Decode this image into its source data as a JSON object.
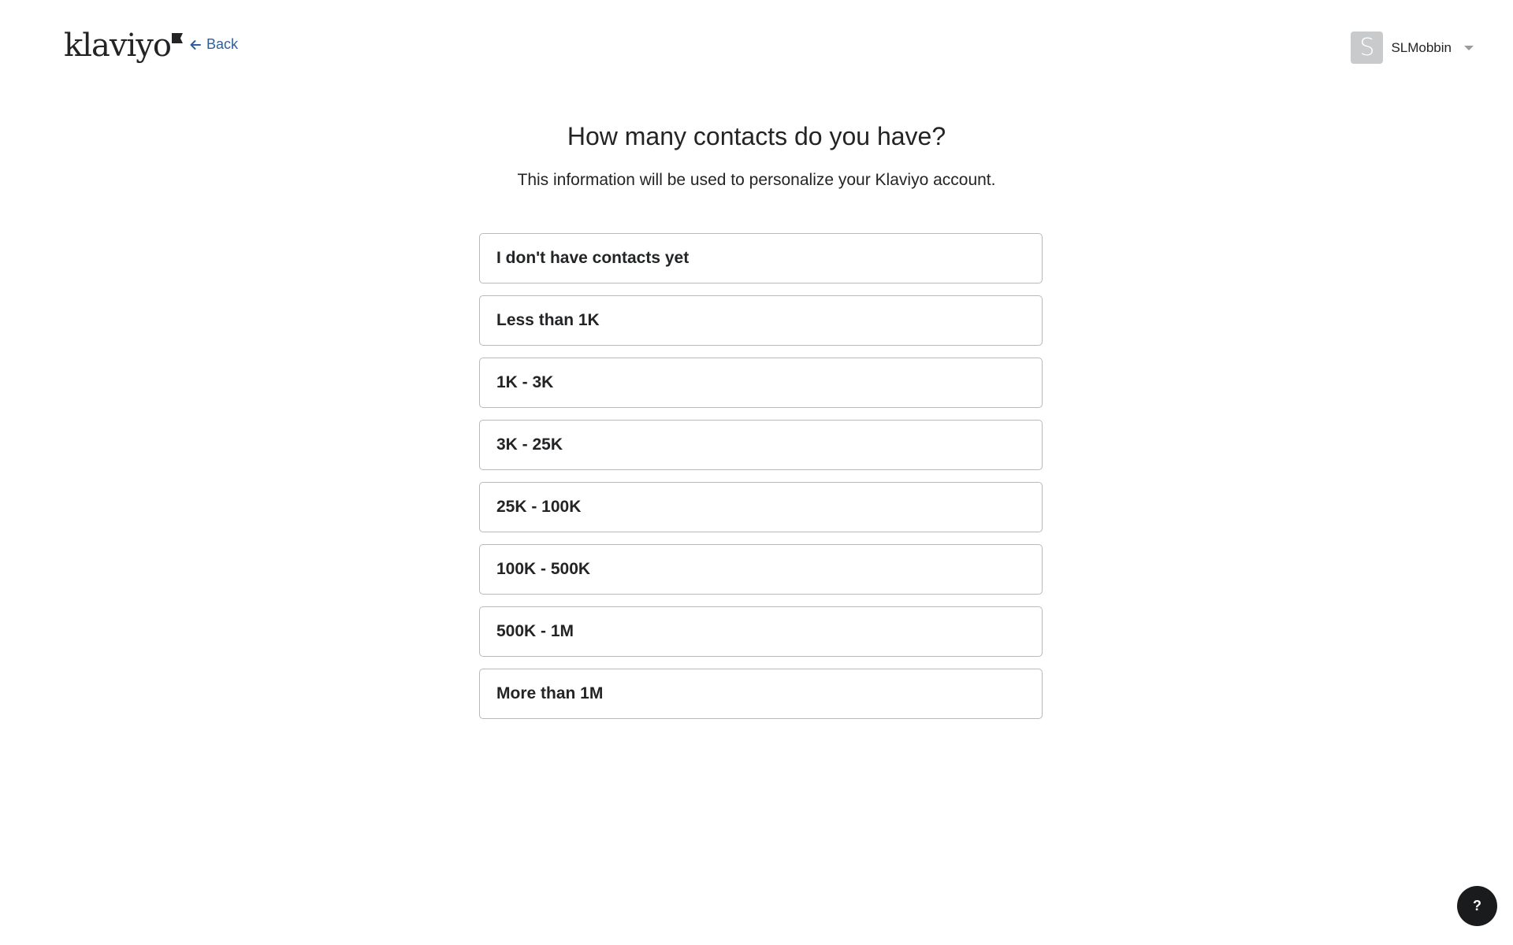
{
  "header": {
    "logo_text": "klaviyo",
    "back_label": "Back",
    "user": {
      "avatar_initial": "S",
      "name": "SLMobbin"
    }
  },
  "main": {
    "title": "How many contacts do you have?",
    "subtitle": "This information will be used to personalize your Klaviyo account.",
    "options": [
      "I don't have contacts yet",
      "Less than 1K",
      "1K - 3K",
      "3K - 25K",
      "25K - 100K",
      "100K - 500K",
      "500K - 1M",
      "More than 1M"
    ]
  },
  "help": {
    "label": "?"
  },
  "colors": {
    "link": "#2c5f9e",
    "text": "#232426",
    "option_border": "#b8b9bb",
    "avatar_bg": "#c9cacc",
    "help_bg": "#1a1b1d"
  }
}
